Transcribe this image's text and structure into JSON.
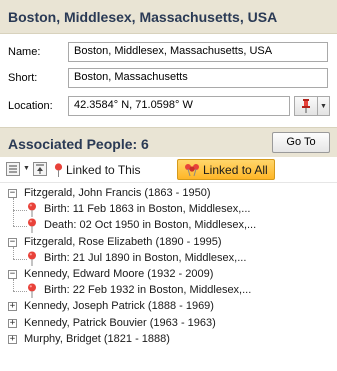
{
  "header": {
    "title": "Boston, Middlesex, Massachusetts, USA"
  },
  "form": {
    "name_label": "Name:",
    "name_value": "Boston, Middlesex, Massachusetts, USA",
    "short_label": "Short:",
    "short_value": "Boston, Massachusetts",
    "location_label": "Location:",
    "location_value": "42.3584° N, 71.0598° W"
  },
  "associated": {
    "title": "Associated People: 6",
    "goto_label": "Go To"
  },
  "toolbar": {
    "linked_this_label": "Linked to This",
    "linked_all_label": "Linked to All"
  },
  "tree": {
    "people": [
      {
        "name": "Fitzgerald, John Francis (1863 - 1950)",
        "expanded": "−",
        "events": [
          "Birth: 11 Feb 1863 in Boston, Middlesex,...",
          "Death: 02 Oct 1950 in Boston, Middlesex,..."
        ]
      },
      {
        "name": "Fitzgerald, Rose Elizabeth (1890 - 1995)",
        "expanded": "−",
        "events": [
          "Birth: 21 Jul 1890 in Boston, Middlesex,..."
        ]
      },
      {
        "name": "Kennedy, Edward Moore (1932 - 2009)",
        "expanded": "−",
        "events": [
          "Birth: 22 Feb 1932 in Boston, Middlesex,..."
        ]
      },
      {
        "name": "Kennedy, Joseph Patrick (1888 - 1969)",
        "expanded": "+",
        "events": []
      },
      {
        "name": "Kennedy, Patrick Bouvier (1963 - 1963)",
        "expanded": "+",
        "events": []
      },
      {
        "name": "Murphy, Bridget (1821 - 1888)",
        "expanded": "+",
        "events": []
      }
    ]
  },
  "colors": {
    "header_bg": "#e9e4d4",
    "title_text": "#2a3a55",
    "pin_red": "#e8423a",
    "active_btn": "#ffb627"
  }
}
